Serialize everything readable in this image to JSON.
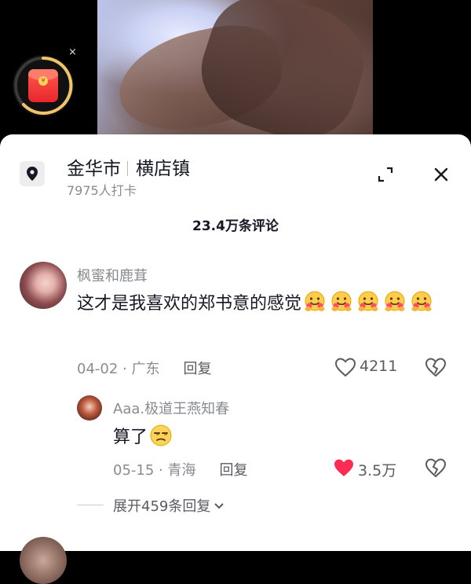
{
  "red_packet": {
    "icon": "red-packet-icon",
    "coin_glyph": "¥",
    "close_glyph": "×"
  },
  "location": {
    "icon": "location-pin-icon",
    "city": "金华市",
    "town": "横店镇",
    "checkins": "7975人打卡"
  },
  "header": {
    "comment_count": "23.4万条评论"
  },
  "comments": [
    {
      "username": "枫蜜和鹿茸",
      "text": "这才是我喜欢的郑书意的感觉",
      "emoji": "hugging-face-emoji",
      "emoji_count": 5,
      "date": "04-02",
      "region": "广东",
      "reply_label": "回复",
      "likes": "4211",
      "liked": false,
      "replies": [
        {
          "username": "Aaa.极道王燕知春",
          "text": "算了",
          "emoji": "unamused-face-emoji",
          "date": "05-15",
          "region": "青海",
          "reply_label": "回复",
          "likes": "3.5万",
          "liked": true
        }
      ],
      "expand_label": "展开459条回复"
    }
  ],
  "colors": {
    "like_active": "#fe2c55",
    "text_primary": "#161823",
    "text_secondary": "#8a8b91"
  }
}
